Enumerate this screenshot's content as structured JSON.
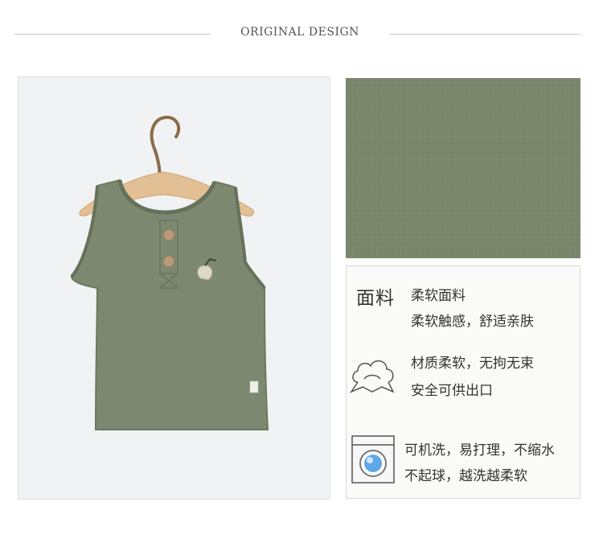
{
  "header": {
    "title": "ORIGINAL DESIGN"
  },
  "product": {
    "image_icon": "green-tank-top-photo-icon",
    "fabric_icon": "fabric-swatch-icon",
    "colors": {
      "garment": "#7b876c",
      "background": "#f1f2f4"
    }
  },
  "features": {
    "heading": "面料",
    "fabric": {
      "line1": "柔软面料",
      "line2": "柔软触感，舒适亲肤"
    },
    "soft": {
      "icon": "cloud-icon",
      "line1": "材质柔软，无拘无束",
      "line2": "安全可供出口"
    },
    "wash": {
      "icon": "washing-machine-icon",
      "line1": "可机洗，易打理，不缩水",
      "line2": "不起球，越洗越柔软"
    }
  }
}
